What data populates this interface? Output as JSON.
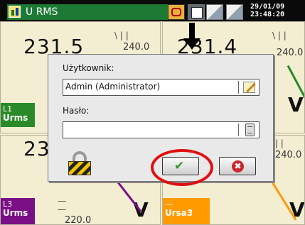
{
  "window": {
    "title": "U RMS",
    "date": "29/01/09",
    "time": "23:48:20"
  },
  "meters": [
    {
      "value": "231.5",
      "scale_label": "240.0",
      "tag_top": "L1",
      "tag_bottom": "Urms",
      "unit": "V"
    },
    {
      "value": "231.4",
      "scale_label": "240.0",
      "unit": "V"
    },
    {
      "value": "23",
      "scale_label": "220.0",
      "tag_top": "L3",
      "tag_bottom": "Urms",
      "unit": "V"
    },
    {
      "value": "",
      "scale_label": "240.0",
      "tag_top": "—",
      "tag_bottom": "Ursa3",
      "unit": "V"
    }
  ],
  "login_dialog": {
    "user_label": "Użytkownik:",
    "user_value": "Admin (Administrator)",
    "password_label": "Hasło:",
    "password_value": ""
  },
  "colors": {
    "ok_check": "#2f9a2f",
    "cancel": "#c8282e",
    "highlight": "#e01010"
  }
}
